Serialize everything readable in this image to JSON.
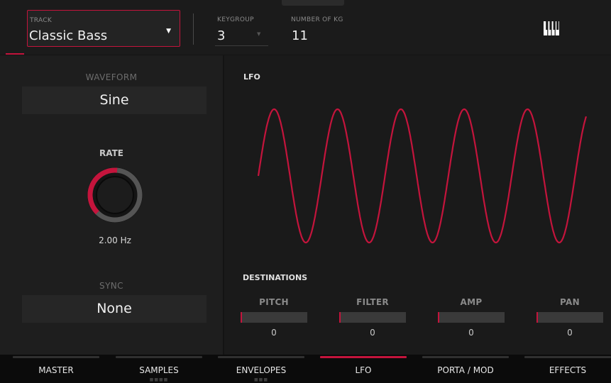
{
  "header": {
    "track_label": "TRACK",
    "track_value": "Classic Bass",
    "keygroup_label": "KEYGROUP",
    "keygroup_value": "3",
    "num_kg_label": "NUMBER OF KG",
    "num_kg_value": "11",
    "keyboard_icon": "piano-keys-icon"
  },
  "left": {
    "waveform_label": "WAVEFORM",
    "waveform_value": "Sine",
    "rate_label": "RATE",
    "rate_value": "2.00 Hz",
    "sync_label": "SYNC",
    "sync_value": "None"
  },
  "lfo": {
    "title": "LFO",
    "waveform": "sine",
    "cycles_shown": 5,
    "line_color": "#c4143c"
  },
  "destinations": {
    "title": "DESTINATIONS",
    "items": [
      {
        "label": "PITCH",
        "value": "0"
      },
      {
        "label": "FILTER",
        "value": "0"
      },
      {
        "label": "AMP",
        "value": "0"
      },
      {
        "label": "PAN",
        "value": "0"
      }
    ]
  },
  "tabs": [
    {
      "label": "MASTER",
      "active": false,
      "dots": ""
    },
    {
      "label": "SAMPLES",
      "active": false,
      "dots": "■■■■"
    },
    {
      "label": "ENVELOPES",
      "active": false,
      "dots": "■■■"
    },
    {
      "label": "LFO",
      "active": true,
      "dots": ""
    },
    {
      "label": "PORTA / MOD",
      "active": false,
      "dots": ""
    },
    {
      "label": "EFFECTS",
      "active": false,
      "dots": ""
    }
  ],
  "colors": {
    "accent": "#c4143c",
    "background": "#141414"
  }
}
